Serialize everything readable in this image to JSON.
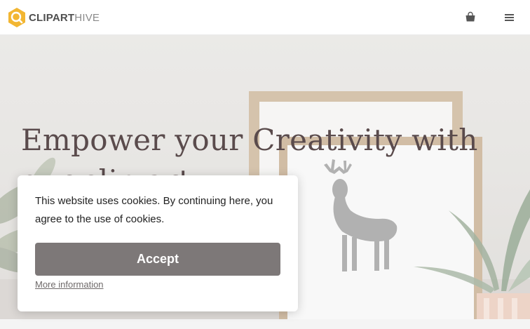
{
  "header": {
    "logo_strong": "CLIPART",
    "logo_light": "HIVE",
    "logo_icon": "hexagon-search-logo",
    "cart_icon": "shopping-bag-icon",
    "menu_icon": "hamburger-menu-icon"
  },
  "hero": {
    "title": "Empower your Creativity with our clip art"
  },
  "cookie_banner": {
    "message": "This website uses cookies. By continuing here, you agree to the use of cookies.",
    "accept_label": "Accept",
    "more_label": "More information"
  },
  "colors": {
    "brand_yellow": "#f2b632",
    "accept_button": "#7d7878",
    "hero_title": "#5a4b4c"
  }
}
